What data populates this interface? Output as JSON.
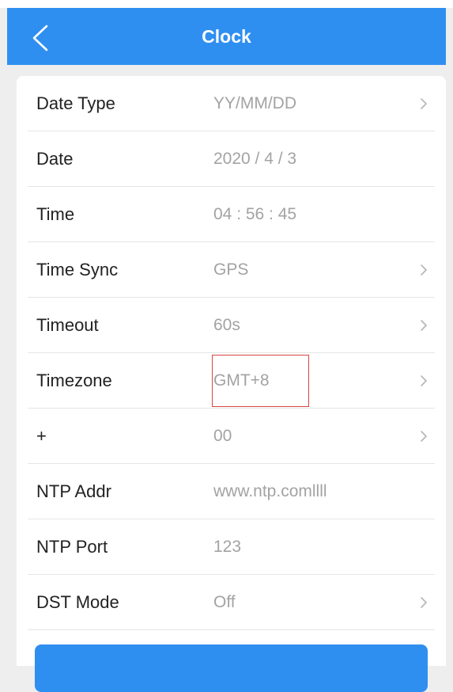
{
  "header": {
    "title": "Clock"
  },
  "rows": [
    {
      "label": "Date Type",
      "value": "YY/MM/DD",
      "chevron": true
    },
    {
      "label": "Date",
      "value": "2020 / 4 / 3",
      "chevron": false
    },
    {
      "label": "Time",
      "value": "04 : 56 : 45",
      "chevron": false
    },
    {
      "label": "Time Sync",
      "value": "GPS",
      "chevron": true
    },
    {
      "label": "Timeout",
      "value": "60s",
      "chevron": true
    },
    {
      "label": "Timezone",
      "value": "GMT+8",
      "chevron": true,
      "highlighted": true
    },
    {
      "label": "+",
      "value": "00",
      "chevron": true
    },
    {
      "label": "NTP Addr",
      "value": "www.ntp.comllll",
      "chevron": false
    },
    {
      "label": "NTP Port",
      "value": "123",
      "chevron": false
    },
    {
      "label": "DST Mode",
      "value": "Off",
      "chevron": true
    }
  ],
  "colors": {
    "accent": "#2f8ff0",
    "highlight_border": "#d94545",
    "value_text": "#a3a3a3"
  }
}
